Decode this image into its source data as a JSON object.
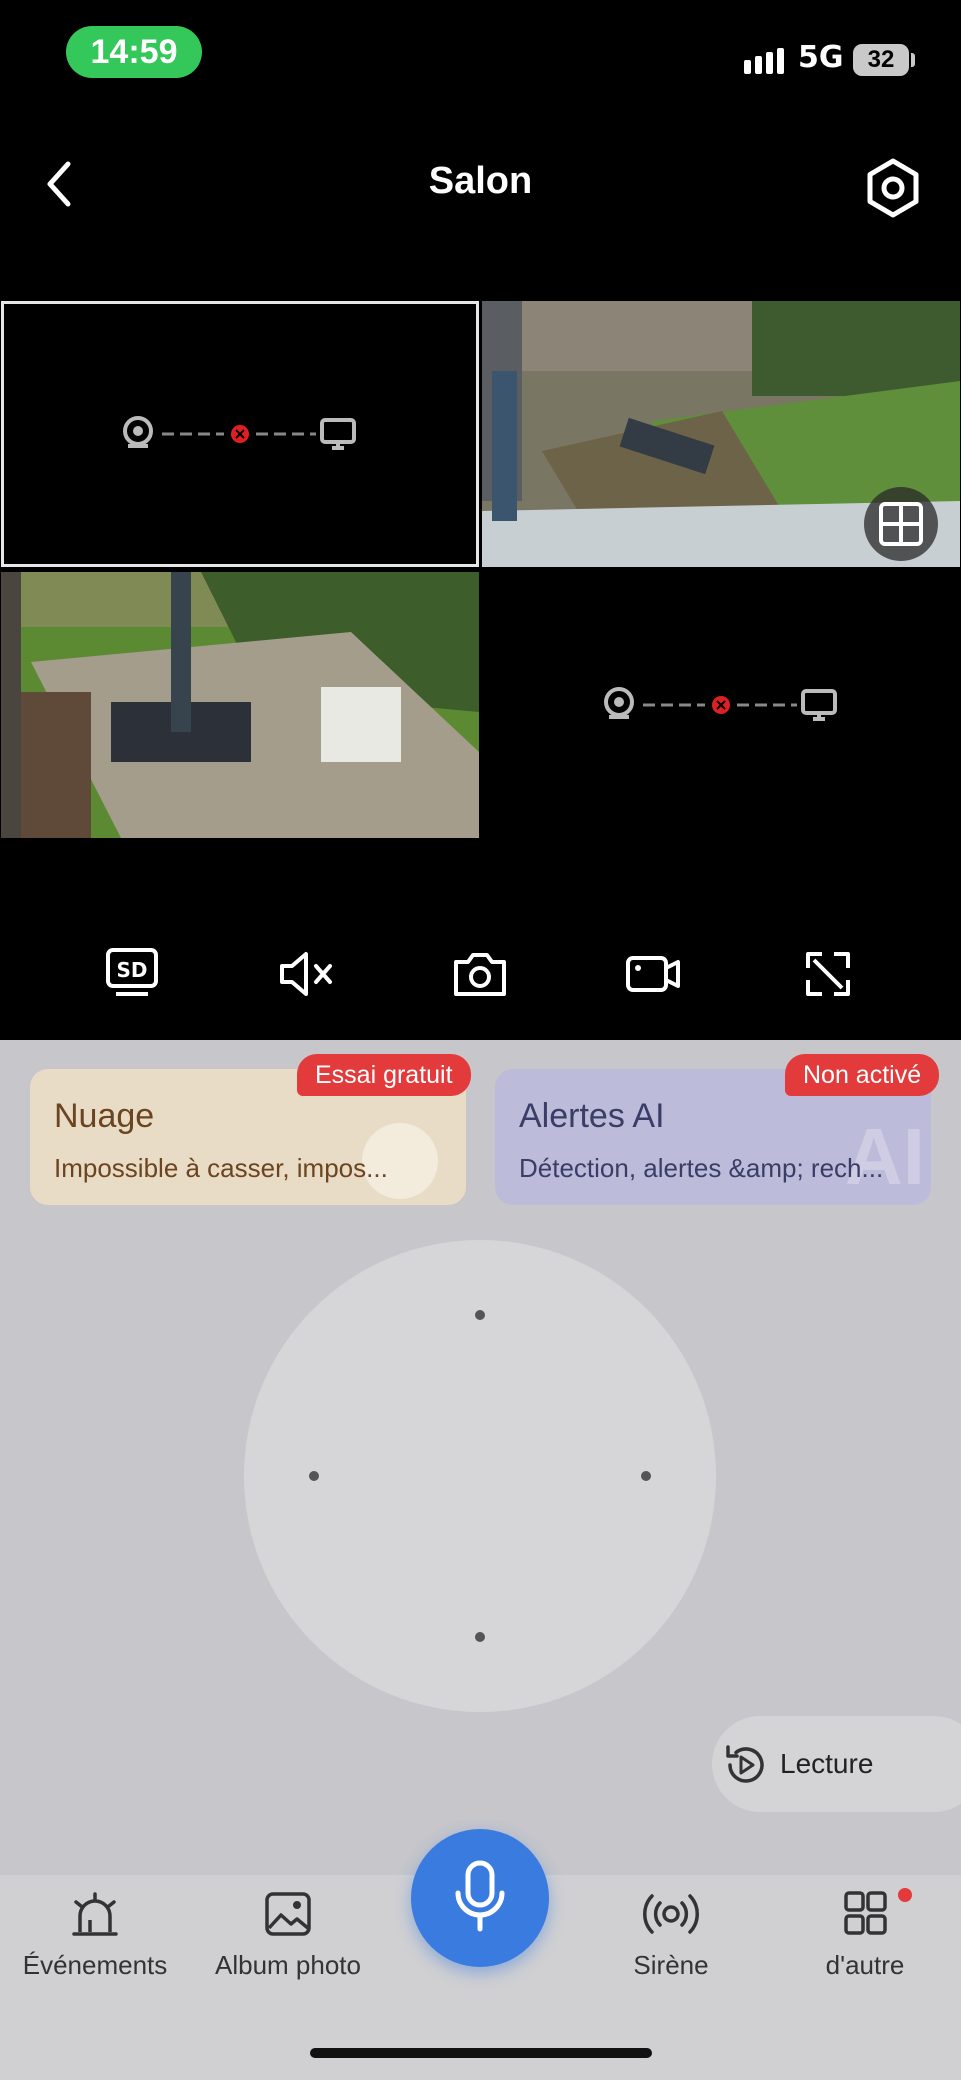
{
  "status": {
    "time": "14:59",
    "network": "5G",
    "battery": "32"
  },
  "header": {
    "title": "Salon"
  },
  "cards": {
    "cloud": {
      "title": "Nuage",
      "subtitle": "Impossible à casser, impos...",
      "badge": "Essai gratuit"
    },
    "ai": {
      "title": "Alertes AI",
      "subtitle": "Détection, alertes &amp; rech...",
      "badge": "Non activé",
      "watermark": "AI"
    }
  },
  "playback": {
    "label": "Lecture"
  },
  "nav": {
    "events": "Événements",
    "album": "Album photo",
    "siren": "Sirène",
    "more": "d'autre"
  },
  "colors": {
    "accent": "#3a7be0",
    "badge": "#e33b3b",
    "status_green": "#34c759"
  }
}
